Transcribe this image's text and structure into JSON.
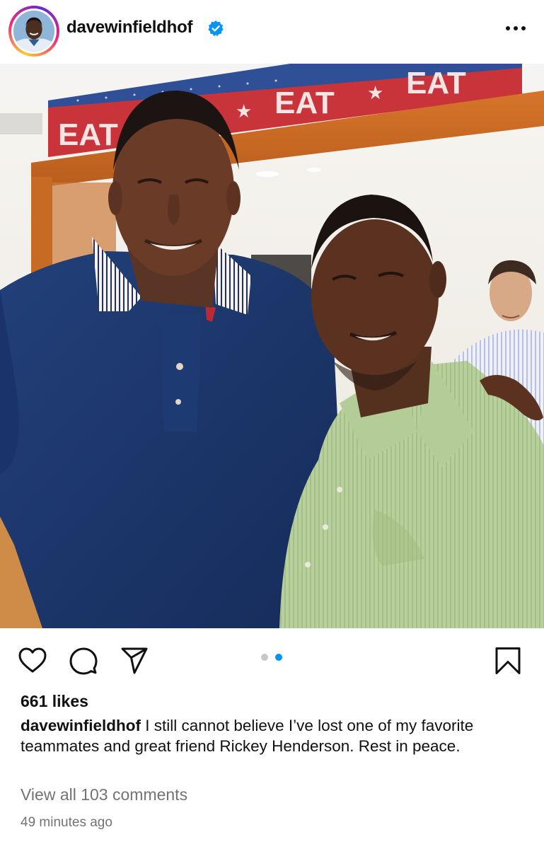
{
  "post": {
    "username": "davewinfieldhof",
    "verified": true,
    "likes": "661 likes",
    "caption_user": "davewinfieldhof",
    "caption_text": "I still cannot believe I’ve lost one of my favorite teammates and great friend Rickey Henderson. Rest in peace.",
    "comments_link": "View all 103 comments",
    "timestamp": "49 minutes ago",
    "carousel": {
      "count": 2,
      "active_index": 1
    }
  },
  "photo": {
    "signage": [
      "EAT",
      "EAT",
      "EAT"
    ]
  },
  "icons": {
    "more": "more-horizontal-icon",
    "like": "heart-icon",
    "comment": "comment-icon",
    "share": "send-icon",
    "save": "bookmark-icon",
    "verified": "verified-badge-icon"
  },
  "colors": {
    "verified_blue": "#0095f6",
    "carousel_active": "#0095f6",
    "carousel_inactive": "#c7c7c7",
    "secondary_text": "#737373"
  }
}
